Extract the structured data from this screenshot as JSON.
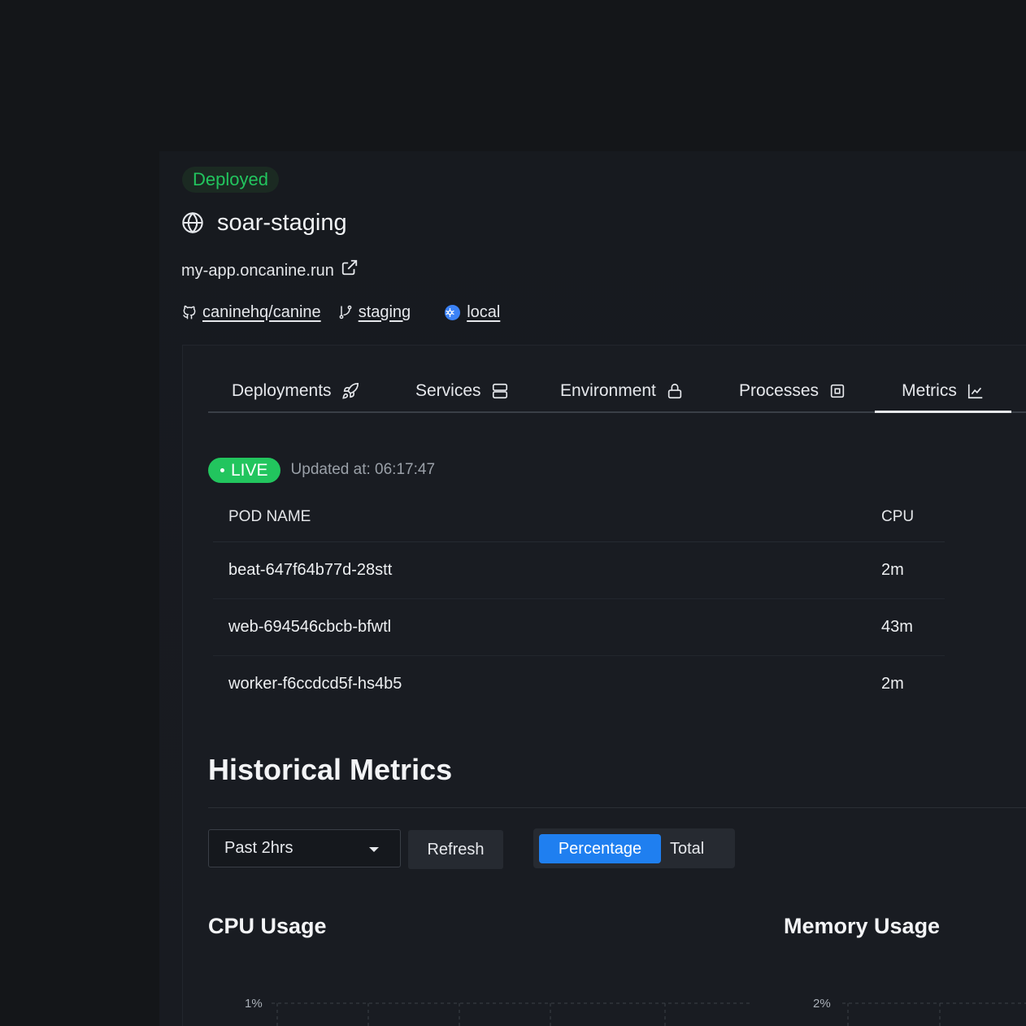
{
  "status_badge": "Deployed",
  "project": {
    "title": "soar-staging",
    "url": "my-app.oncanine.run",
    "repo": "caninehq/canine",
    "branch": "staging",
    "cluster": "local"
  },
  "tabs": [
    {
      "label": "Deployments",
      "icon": "rocket-icon"
    },
    {
      "label": "Services",
      "icon": "server-icon"
    },
    {
      "label": "Environment",
      "icon": "lock-icon"
    },
    {
      "label": "Processes",
      "icon": "cpu-chip-icon"
    },
    {
      "label": "Metrics",
      "icon": "chart-line-icon",
      "active": true
    }
  ],
  "live": {
    "label": "LIVE",
    "updated": "Updated at: 06:17:47"
  },
  "pods_table": {
    "headers": [
      "POD NAME",
      "CPU"
    ],
    "rows": [
      {
        "name": "beat-647f64b77d-28stt",
        "cpu": "2m"
      },
      {
        "name": "web-694546cbcb-bfwtl",
        "cpu": "43m"
      },
      {
        "name": "worker-f6ccdcd5f-hs4b5",
        "cpu": "2m"
      }
    ]
  },
  "historical": {
    "title": "Historical Metrics",
    "range_select": "Past 2hrs",
    "refresh_label": "Refresh",
    "mode_options": [
      "Percentage",
      "Total"
    ],
    "mode_selected": "Percentage"
  },
  "charts": {
    "cpu": {
      "title": "CPU Usage",
      "top_tick": "1%"
    },
    "memory": {
      "title": "Memory Usage",
      "top_tick": "2%"
    }
  },
  "colors": {
    "accent_green": "#22c55e",
    "accent_blue": "#1f7ff0"
  }
}
